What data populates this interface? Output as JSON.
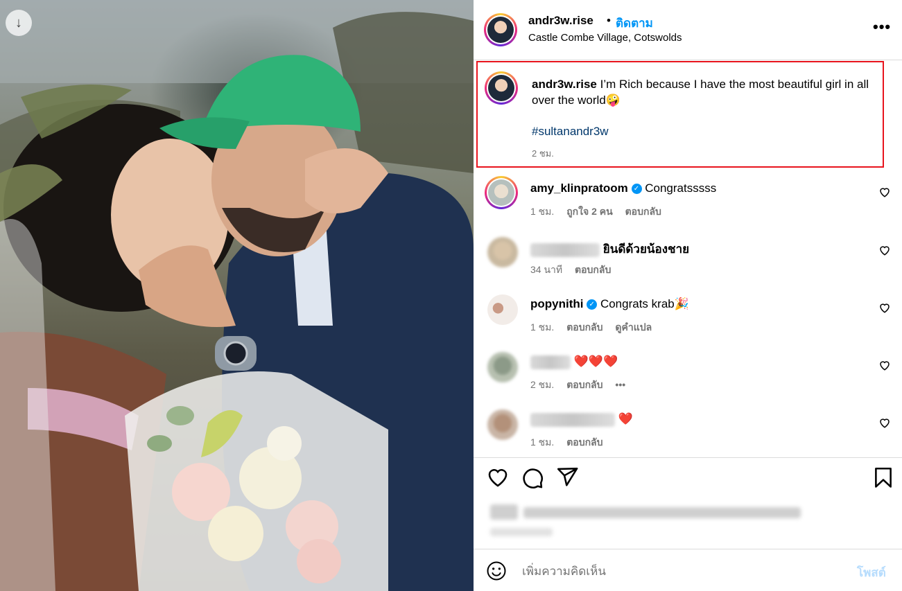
{
  "post": {
    "username": "andr3w.rise",
    "follow_label": "ติดตาม",
    "separator_dot": "•",
    "location": "Castle Combe Village, Cotswolds",
    "more_label": "•••"
  },
  "caption": {
    "username": "andr3w.rise",
    "text": "I’m Rich because I have the most beautiful girl in all over the world🤪",
    "hashtag": "#sultanandr3w",
    "time": "2 ชม."
  },
  "comments": [
    {
      "username": "amy_klinpratoom",
      "verified": true,
      "text": "Congratsssss",
      "time": "1 ชม.",
      "likes": "ถูกใจ 2 คน",
      "reply": "ตอบกลับ"
    },
    {
      "username": "",
      "blurred": true,
      "text": "ยินดีด้วยน้องชาย",
      "time": "34 นาที",
      "reply": "ตอบกลับ"
    },
    {
      "username": "popynithi",
      "verified": true,
      "text": "Congrats krab🎉",
      "time": "1 ชม.",
      "reply": "ตอบกลับ",
      "translate": "ดูคำแปล"
    },
    {
      "username": "",
      "blurred": true,
      "text": "❤️❤️❤️",
      "time": "2 ชม.",
      "reply": "ตอบกลับ",
      "more": "•••"
    },
    {
      "username": "",
      "blurred": true,
      "text": "❤️",
      "time": "1 ชม.",
      "reply": "ตอบกลับ"
    }
  ],
  "add_comment": {
    "placeholder": "เพิ่มความคิดเห็น",
    "post_label": "โพสต์"
  },
  "icons": {
    "download": "download-arrow-icon",
    "like": "heart-icon",
    "comment": "comment-bubble-icon",
    "share": "paper-plane-icon",
    "save": "bookmark-icon",
    "emoji": "smiley-icon"
  },
  "colors": {
    "highlight_border": "#e8131c",
    "follow": "#0095f6",
    "hashtag": "#00376b",
    "muted": "#737373",
    "post_disabled": "#b6dcfd"
  }
}
